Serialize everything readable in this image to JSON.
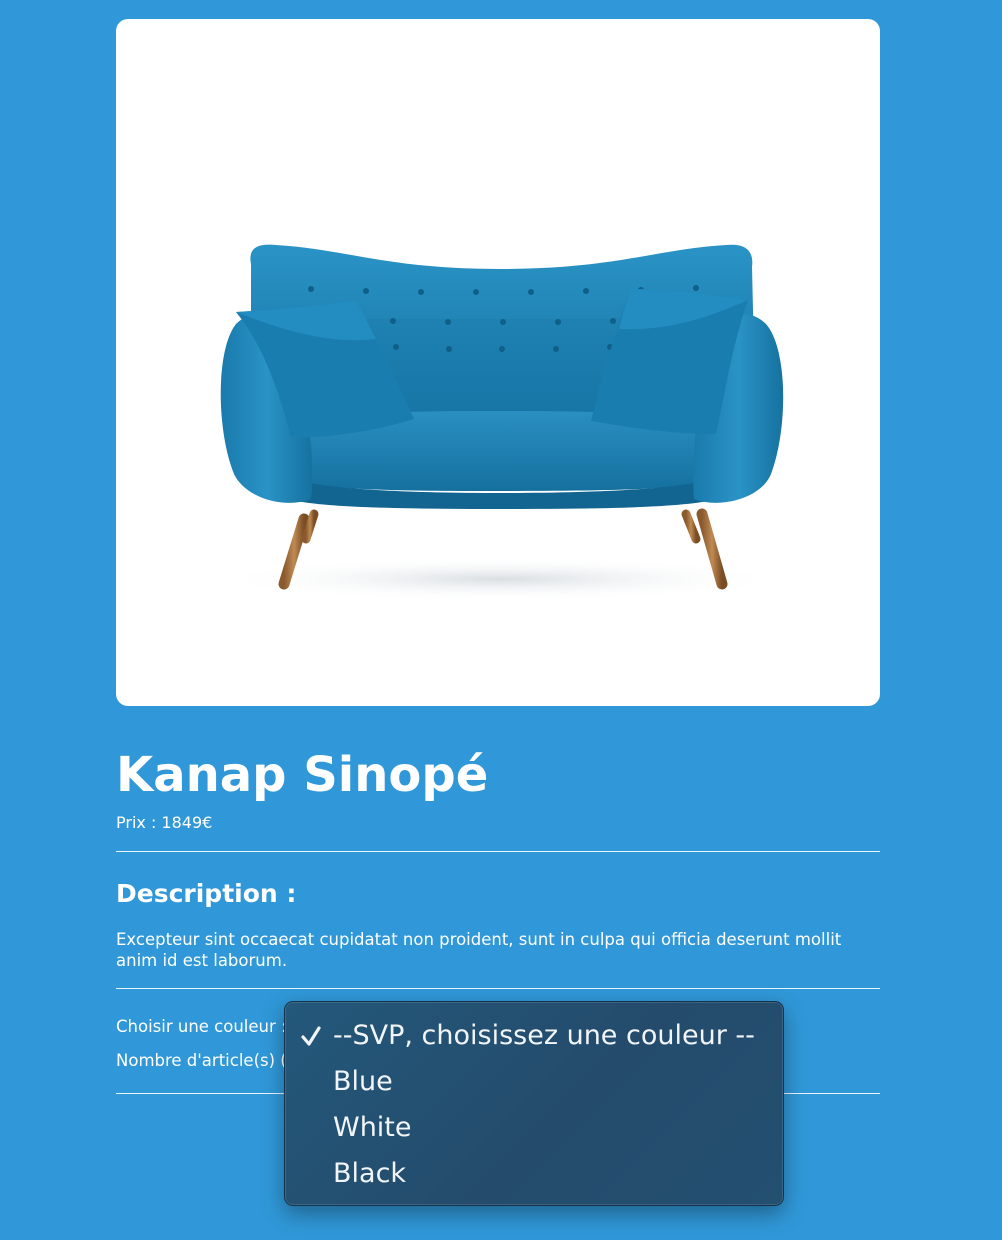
{
  "product": {
    "title": "Kanap Sinopé",
    "price_text": "Prix : 1849€",
    "image_icon": "sofa-image"
  },
  "description": {
    "heading": "Description :",
    "text": "Excepteur sint occaecat cupidatat non proident, sunt in culpa qui officia deserunt mollit anim id est laborum."
  },
  "form": {
    "color_label": "Choisir une couleur :",
    "quantity_label": "Nombre d'article(s) (1-100) :"
  },
  "color_dropdown": {
    "options": [
      "--SVP, choisissez une couleur --",
      "Blue",
      "White",
      "Black"
    ],
    "selected_index": 0,
    "check_icon": "checkmark-icon"
  },
  "colors": {
    "background": "#3098d8",
    "card": "#ffffff",
    "sofa": "#1f86b8",
    "menu": "#244b6c"
  }
}
